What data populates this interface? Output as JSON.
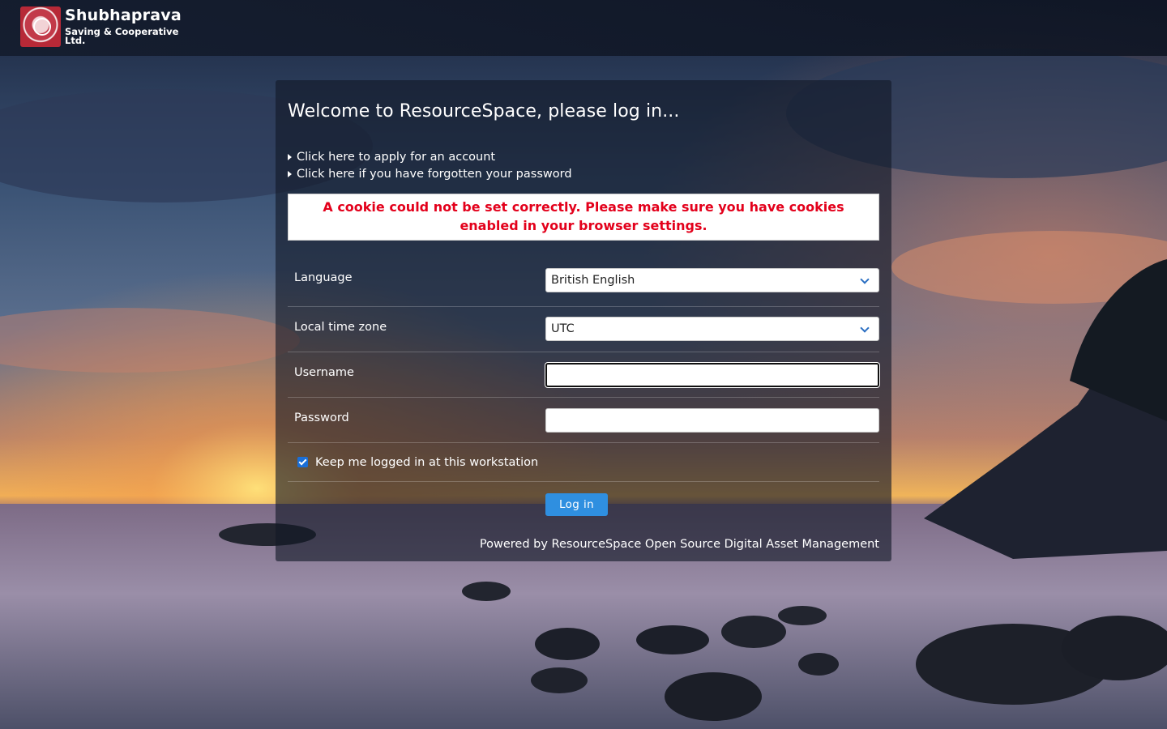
{
  "header": {
    "logo_title": "Shubhaprava",
    "logo_subtitle": "Saving & Cooperative Ltd."
  },
  "login": {
    "heading": "Welcome to ResourceSpace, please log in...",
    "links": [
      "Click here to apply for an account",
      "Click here if you have forgotten your password"
    ],
    "error_message": "A cookie could not be set correctly. Please make sure you have cookies enabled in your browser settings.",
    "fields": {
      "language": {
        "label": "Language",
        "value": "British English"
      },
      "timezone": {
        "label": "Local time zone",
        "value": "UTC"
      },
      "username": {
        "label": "Username",
        "value": ""
      },
      "password": {
        "label": "Password",
        "value": ""
      }
    },
    "keep_logged_in": {
      "label": "Keep me logged in at this workstation",
      "checked": true
    },
    "submit_label": "Log in",
    "powered_by": "Powered by ResourceSpace Open Source Digital Asset Management"
  },
  "colors": {
    "error_text": "#e3001b",
    "button": "#2f8fe0",
    "checkbox": "#1a6fd8"
  }
}
